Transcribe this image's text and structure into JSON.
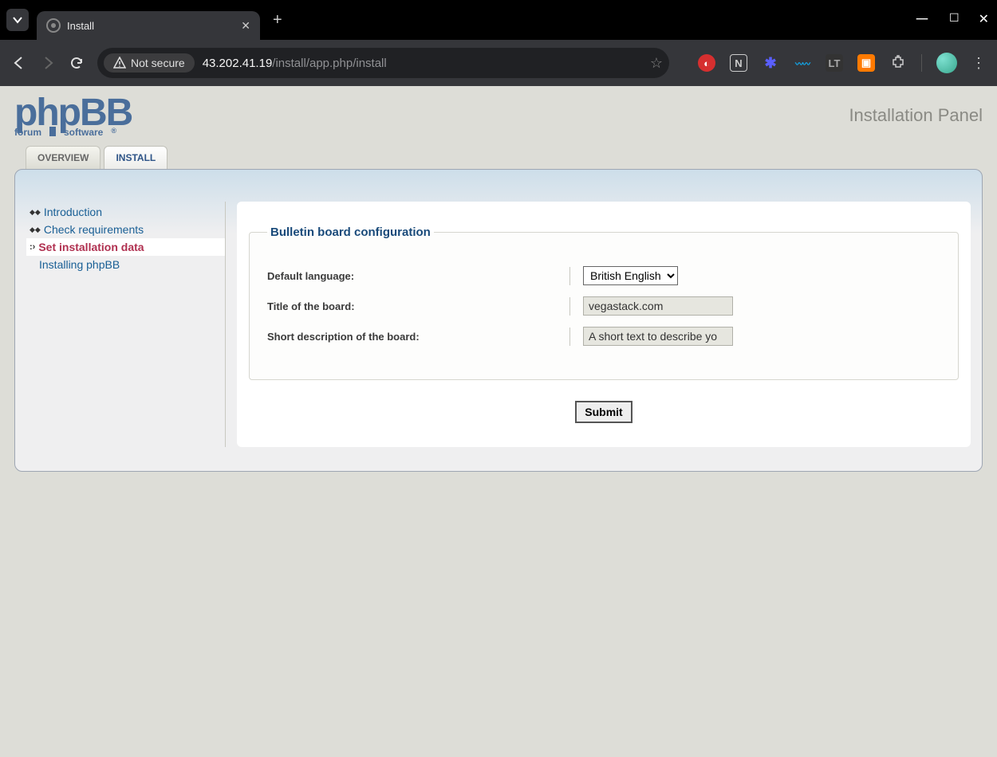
{
  "browser": {
    "tab_title": "Install",
    "not_secure_label": "Not secure",
    "url_host": "43.202.41.19",
    "url_path": "/install/app.php/install"
  },
  "header": {
    "logo_main": "phpBB",
    "logo_sub1": "forum",
    "logo_sub2": "software",
    "panel_title": "Installation Panel"
  },
  "main_tabs": [
    {
      "label": "OVERVIEW",
      "active": false
    },
    {
      "label": "INSTALL",
      "active": true
    }
  ],
  "sidebar": {
    "items": [
      {
        "label": "Introduction",
        "type": "step"
      },
      {
        "label": "Check requirements",
        "type": "step"
      },
      {
        "label": "Set installation data",
        "type": "active"
      },
      {
        "label": "Installing phpBB",
        "type": "plain"
      }
    ]
  },
  "form": {
    "legend": "Bulletin board configuration",
    "default_language_label": "Default language:",
    "default_language_value": "British English",
    "title_label": "Title of the board:",
    "title_value": "vegastack.com",
    "desc_label": "Short description of the board:",
    "desc_value": "A short text to describe yo",
    "submit_label": "Submit"
  }
}
